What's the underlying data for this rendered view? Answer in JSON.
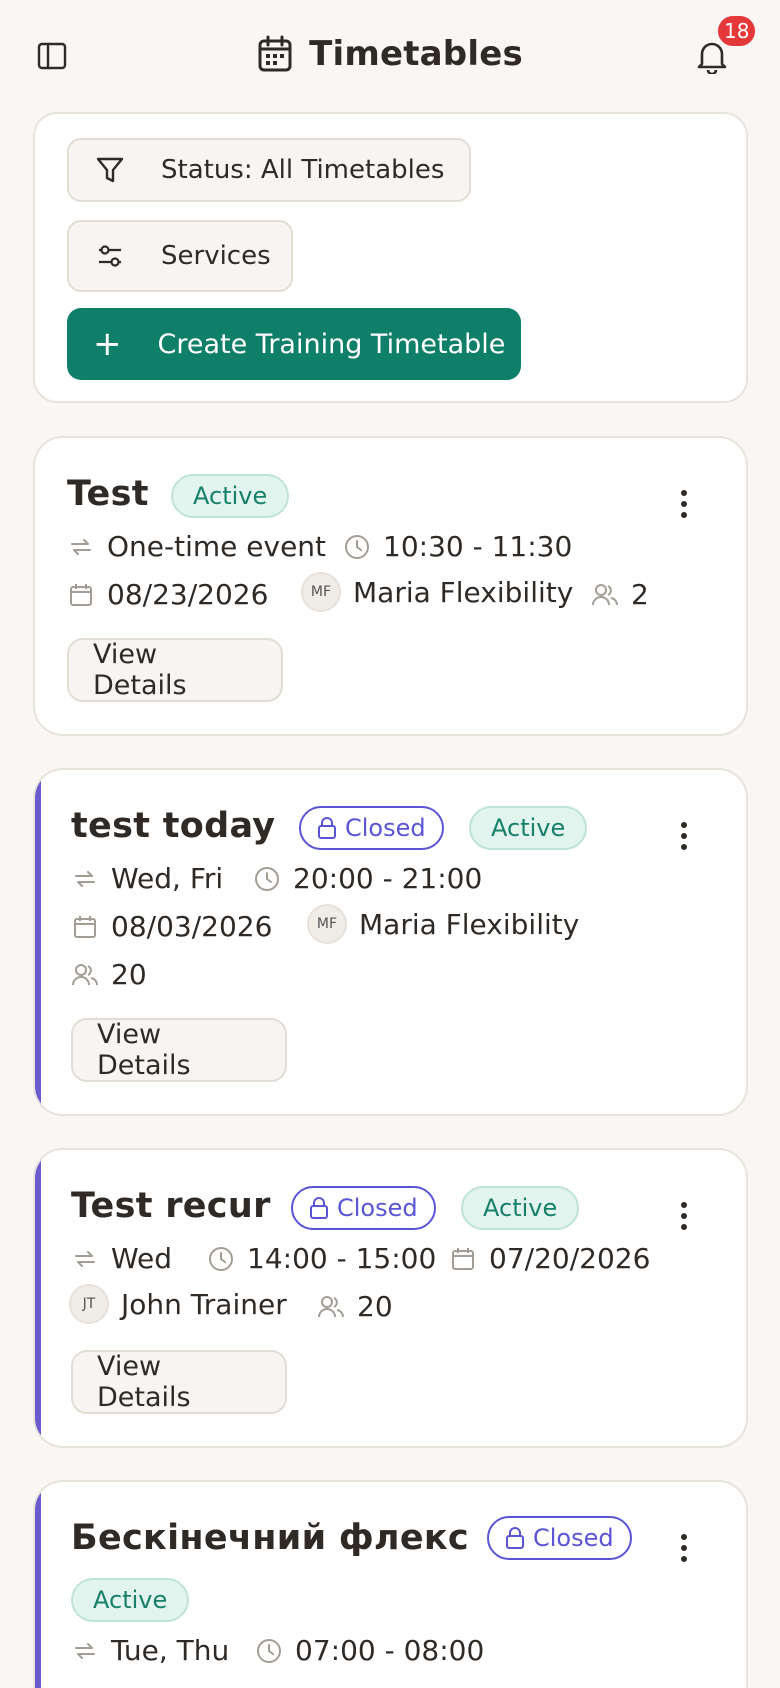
{
  "header": {
    "title": "Timetables",
    "notification_count": "18",
    "icons": {
      "sidebar": "sidebar-toggle-icon",
      "title": "calendar-icon",
      "bell": "bell-icon"
    }
  },
  "filters": {
    "status_label": "Status: All Timetables",
    "services_label": "Services",
    "create_label": "Create Training Timetable"
  },
  "colors": {
    "primary": "#0f7f6a",
    "accent_closed": "#5a55d4",
    "badge_active_bg": "#e2f4ee",
    "notification": "#e5383b"
  },
  "cards": [
    {
      "title": "Test",
      "active_label": "Active",
      "recurrence": "One-time event",
      "time": "10:30 - 11:30",
      "date": "08/23/2026",
      "trainer_initials": "MF",
      "trainer": "Maria Flexibility",
      "participants": "2",
      "view_label": "View Details"
    },
    {
      "title": "test today",
      "closed_label": "Closed",
      "active_label": "Active",
      "recurrence": "Wed, Fri",
      "time": "20:00 - 21:00",
      "date": "08/03/2026",
      "trainer_initials": "MF",
      "trainer": "Maria Flexibility",
      "participants": "20",
      "view_label": "View Details"
    },
    {
      "title": "Test recur",
      "closed_label": "Closed",
      "active_label": "Active",
      "recurrence": "Wed",
      "time": "14:00 - 15:00",
      "date": "07/20/2026",
      "trainer_initials": "JT",
      "trainer": "John Trainer",
      "participants": "20",
      "view_label": "View Details"
    },
    {
      "title": "Бескінечний флекс",
      "closed_label": "Closed",
      "active_label": "Active",
      "recurrence": "Tue, Thu",
      "time": "07:00 - 08:00"
    }
  ]
}
